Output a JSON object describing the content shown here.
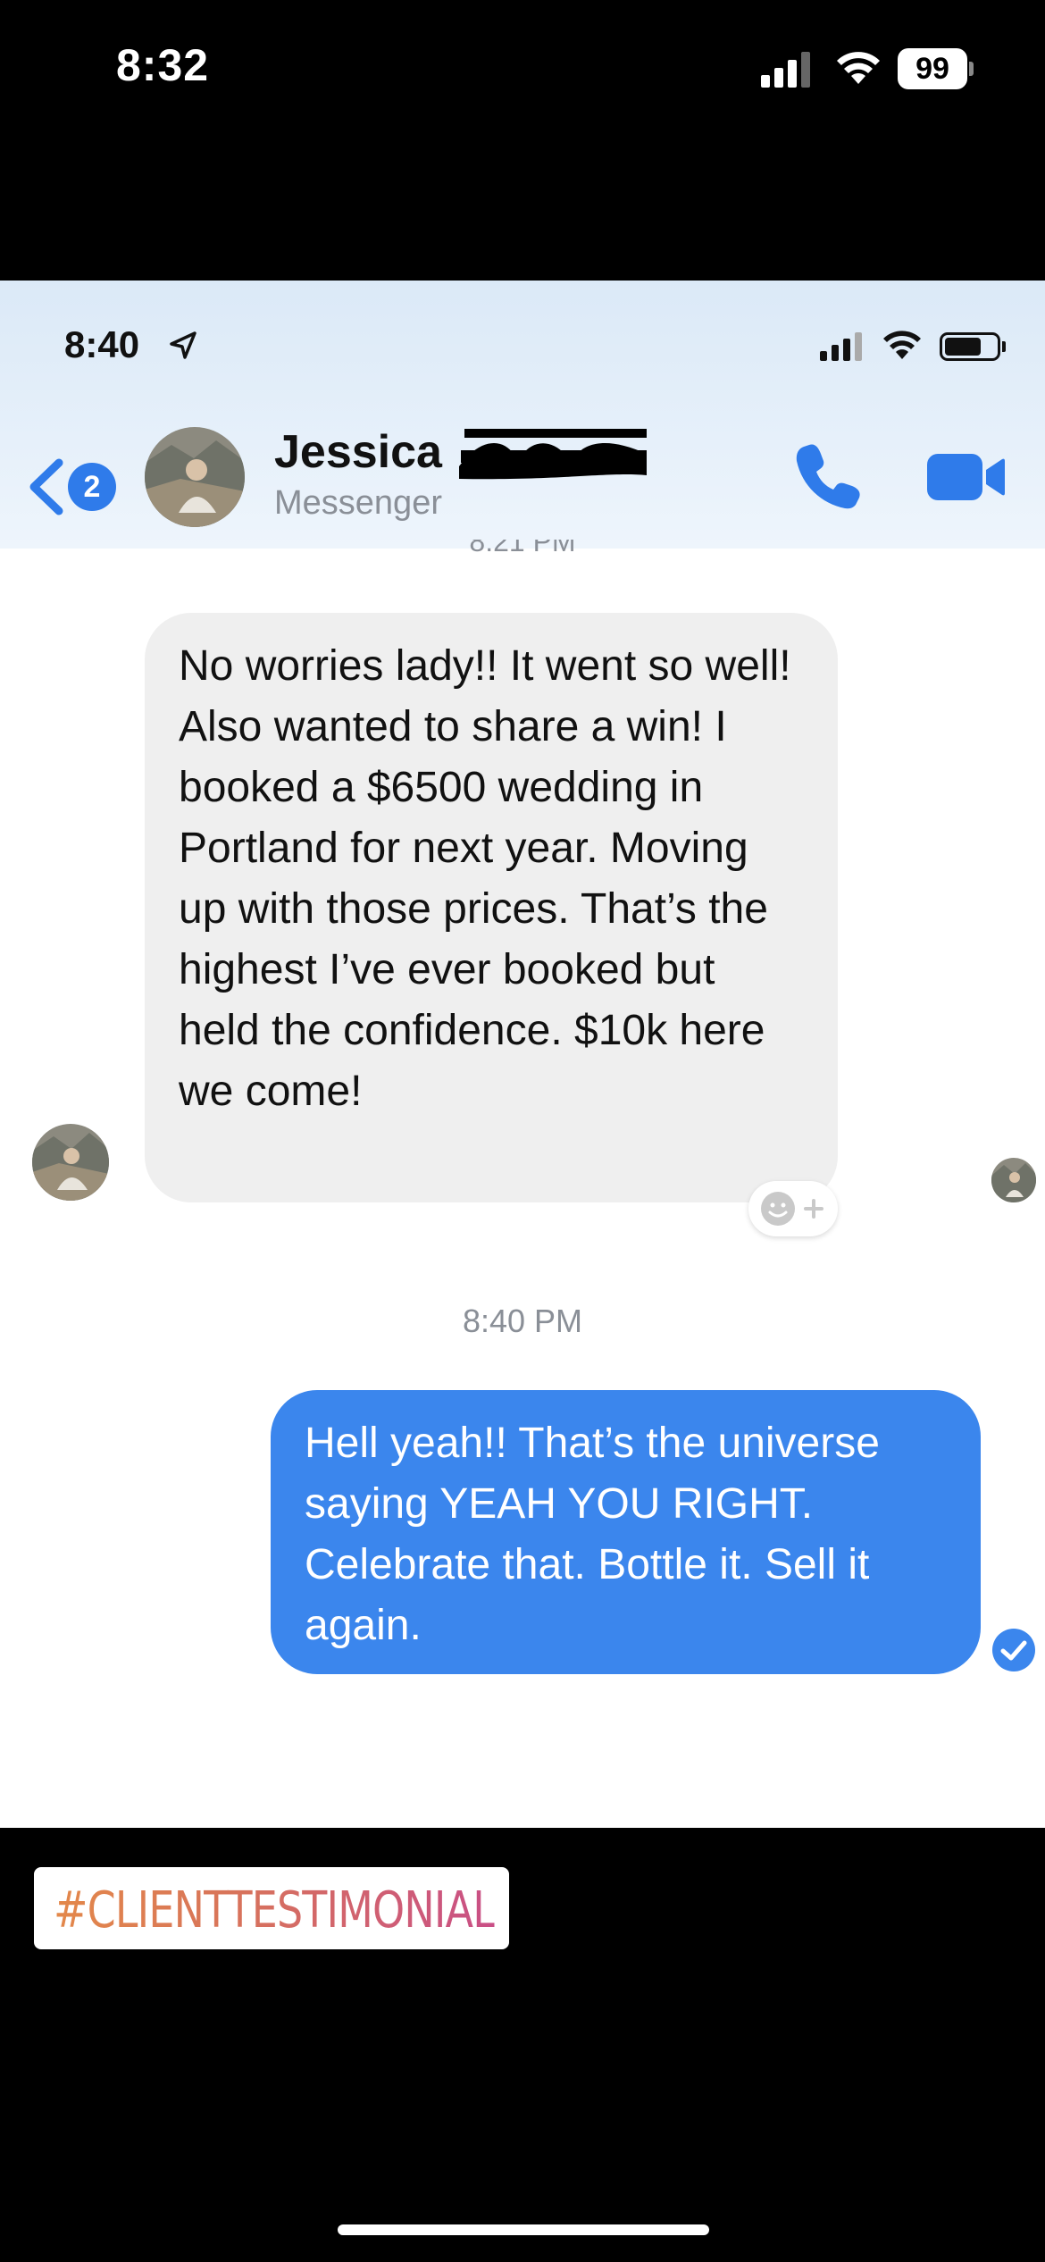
{
  "outer_status": {
    "time": "8:32",
    "battery": "99"
  },
  "inner_status": {
    "time": "8:40"
  },
  "header": {
    "back_badge": "2",
    "contact_name": "Jessica",
    "contact_sub": "Messenger"
  },
  "messages": {
    "partial_time": "8:21 PM",
    "incoming": "No worries lady!! It went so well! Also wanted to share a win! I booked a $6500 wedding in Portland for next year. Moving up with those prices. That’s the highest I’ve ever booked but held the confidence. $10k here we come!",
    "divider_time": "8:40 PM",
    "outgoing": "Hell yeah!! That’s the universe saying YEAH YOU RIGHT. Celebrate that. Bottle it. Sell it again."
  },
  "sticker": {
    "hashtag": "#CLIENTTESTIMONIAL"
  },
  "colors": {
    "messenger_blue": "#3b86ed",
    "incoming_bubble": "#efefef",
    "header_tint": "#dbe9f7",
    "hashtag_gradient_start": "#e3884a",
    "hashtag_gradient_end": "#c94f86"
  },
  "icons": [
    "cellular-signal-icon",
    "wifi-icon",
    "battery-icon",
    "location-arrow-icon",
    "back-chevron-icon",
    "phone-icon",
    "video-camera-icon",
    "add-reaction-icon",
    "sent-check-icon"
  ]
}
